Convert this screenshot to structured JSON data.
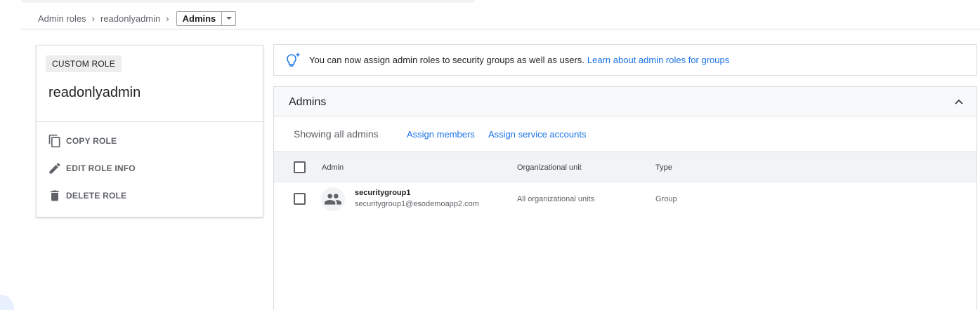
{
  "breadcrumb": {
    "items": [
      "Admin roles",
      "readonlyadmin"
    ],
    "current": "Admins"
  },
  "role": {
    "chip": "CUSTOM ROLE",
    "name": "readonlyadmin",
    "actions": [
      {
        "label": "COPY ROLE",
        "icon": "copy-icon"
      },
      {
        "label": "EDIT ROLE INFO",
        "icon": "pencil-icon"
      },
      {
        "label": "DELETE ROLE",
        "icon": "trash-icon"
      }
    ]
  },
  "banner": {
    "icon": "lightbulb-icon",
    "message": "You can now assign admin roles to security groups as well as users.",
    "link": "Learn about admin roles for groups"
  },
  "panel": {
    "title": "Admins",
    "showing": "Showing all admins",
    "assign_members": "Assign members",
    "assign_service_accounts": "Assign service accounts",
    "columns": [
      "Admin",
      "Organizational unit",
      "Type"
    ],
    "rows": [
      {
        "name": "securitygroup1",
        "email": "securitygroup1@esodemoapp2.com",
        "org_unit": "All organizational units",
        "type": "Group"
      }
    ]
  },
  "colors": {
    "link": "#1a73e8",
    "text": "#202124",
    "muted": "#5f6368"
  }
}
